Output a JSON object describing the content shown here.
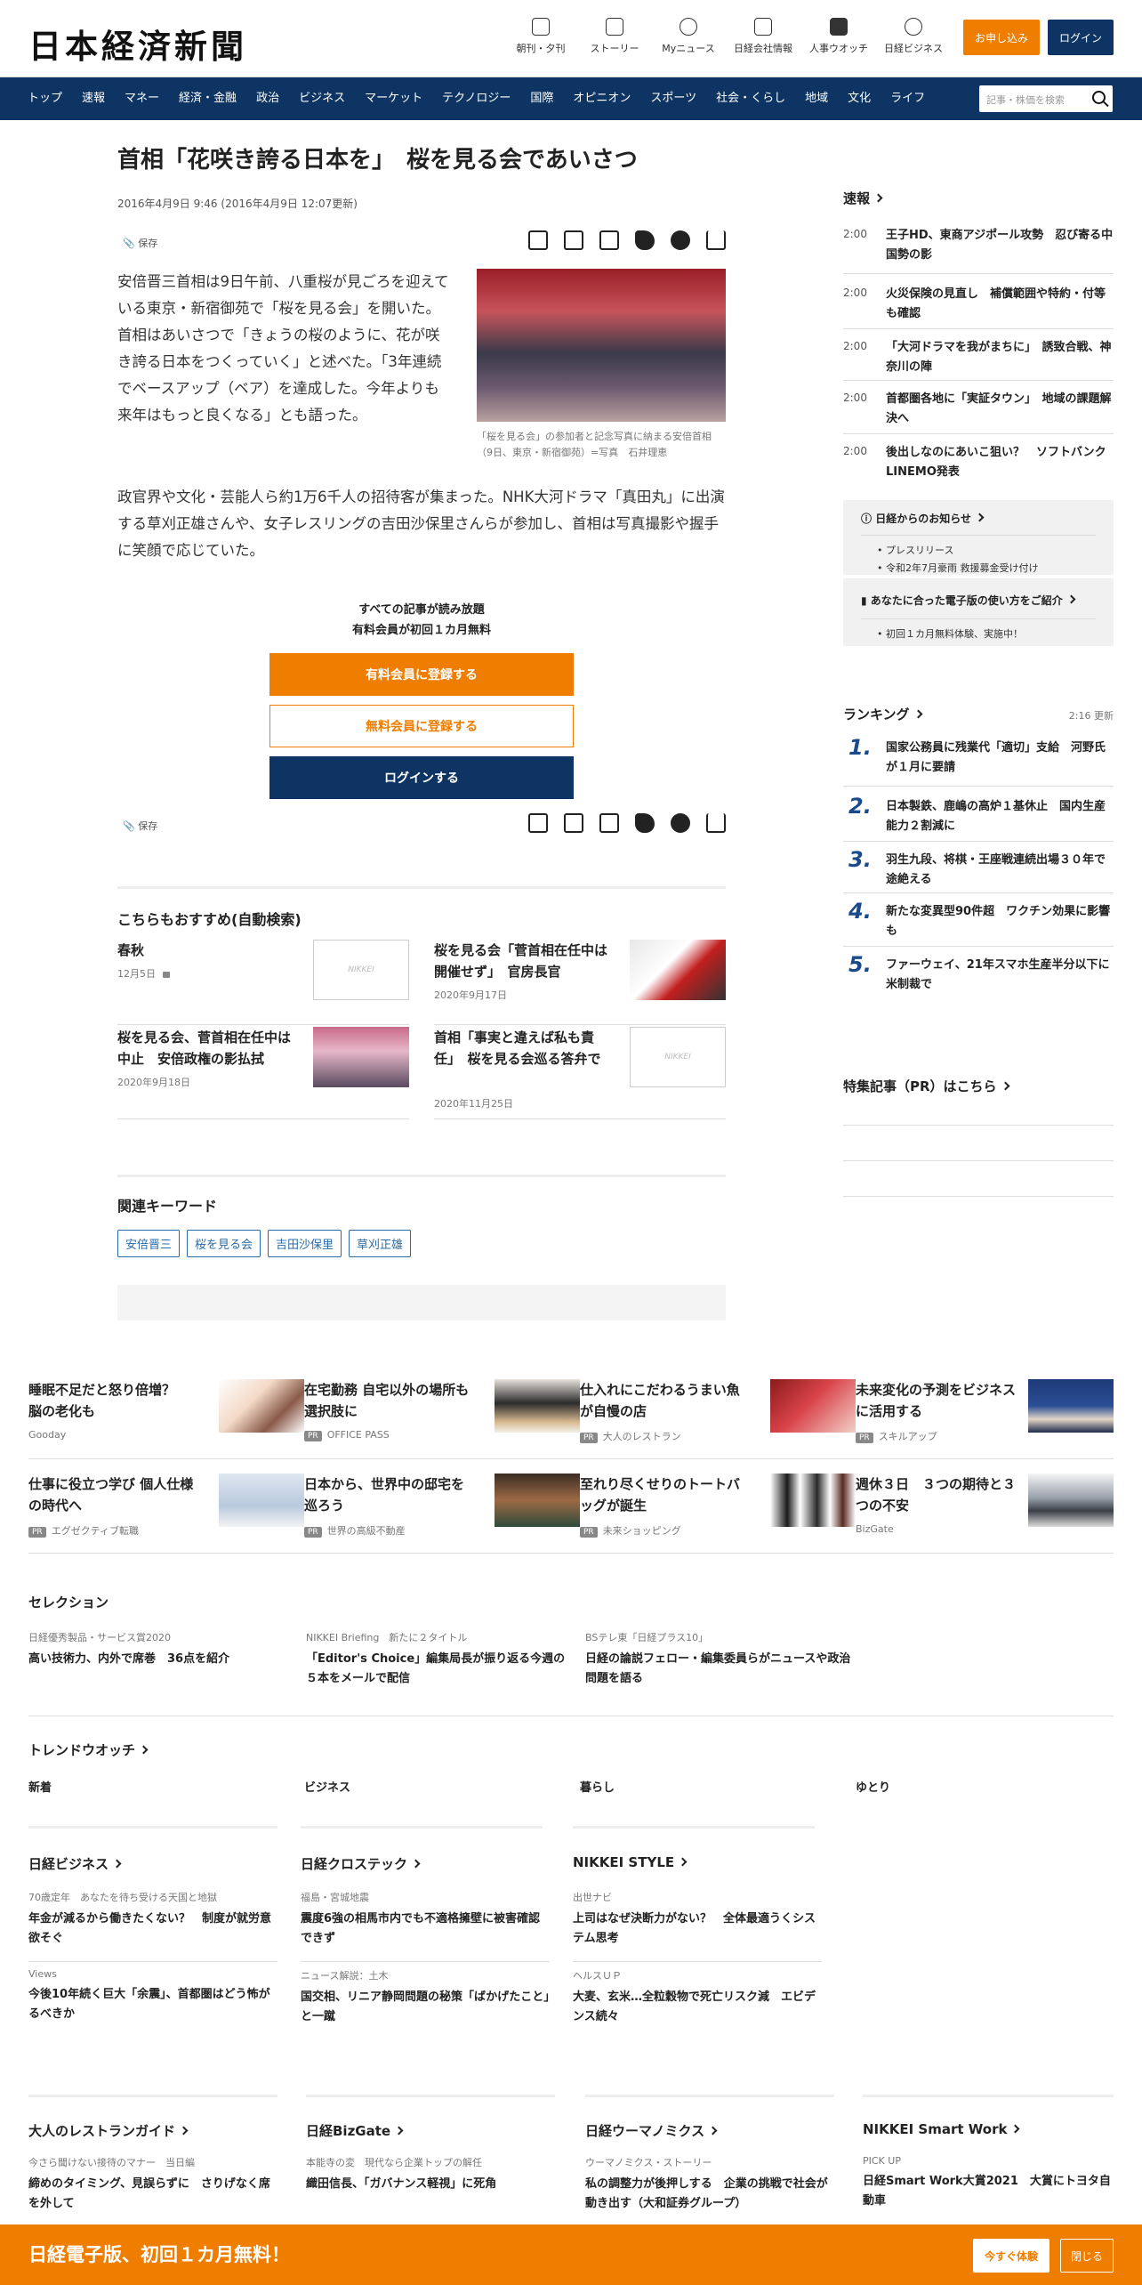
{
  "header": {
    "logo": "日本経済新聞",
    "utils": [
      "朝刊・夕刊",
      "ストーリー",
      "Myニュース",
      "日経会社情報",
      "人事ウオッチ",
      "日経ビジネス"
    ],
    "subscribe": "お申し込み",
    "login": "ログイン"
  },
  "nav": {
    "items": [
      "トップ",
      "速報",
      "マネー",
      "経済・金融",
      "政治",
      "ビジネス",
      "マーケット",
      "テクノロジー",
      "国際",
      "オピニオン",
      "スポーツ",
      "社会・くらし",
      "地域",
      "文化",
      "ライフ"
    ],
    "search_placeholder": "記事・株価を検索"
  },
  "article": {
    "title": "首相「花咲き誇る日本を」　桜を見る会であいさつ",
    "date": "2016年4月9日 9:46 (2016年4月9日 12:07更新)",
    "save": "保存",
    "para1": "安倍晋三首相は9日午前、八重桜が見ごろを迎えている東京・新宿御苑で「桜を見る会」を開いた。首相はあいさつで「きょうの桜のように、花が咲き誇る日本をつくっていく」と述べた。「3年連続でベースアップ（ベア）を達成した。今年よりも来年はもっと良くなる」とも語った。",
    "para2": "政官界や文化・芸能人ら約1万6千人の招待客が集まった。NHK大河ドラマ「真田丸」に出演する草刈正雄さんや、女子レスリングの吉田沙保里さんらが参加し、首相は写真撮影や握手に笑顔で応じていた。",
    "caption": "「桜を見る会」の参加者と記念写真に納まる安倍首相（9日、東京・新宿御苑）=写真　石井理恵",
    "paywall": {
      "line1": "すべての記事が読み放題",
      "line2": "有料会員が初回１カ月無料",
      "btn_paid": "有料会員に登録する",
      "btn_free": "無料会員に登録する",
      "btn_login": "ログインする"
    }
  },
  "recommend": {
    "heading": "こちらもおすすめ(自動検索)",
    "items": [
      {
        "title": "春秋",
        "date": "12月5日"
      },
      {
        "title": "桜を見る会「菅首相在任中は開催せず」　官房長官",
        "date": "2020年9月17日"
      },
      {
        "title": "桜を見る会、菅首相在任中は中止　安倍政権の影払拭",
        "date": "2020年9月18日"
      },
      {
        "title": "首相「事実と違えば私も責任」　桜を見る会巡る答弁で",
        "date": "2020年11月25日"
      }
    ],
    "nikkei_placeholder": "NIKKEI"
  },
  "keywords": {
    "heading": "関連キーワード",
    "items": [
      "安倍晋三",
      "桜を見る会",
      "吉田沙保里",
      "草刈正雄"
    ]
  },
  "sidebar": {
    "breaking_heading": "速報",
    "breaking": [
      {
        "time": "2:00",
        "text": "王子HD、東商アジポール攻勢　忍び寄る中国勢の影"
      },
      {
        "time": "2:00",
        "text": "火災保険の見直し　補償範囲や特約・付等も確認"
      },
      {
        "time": "2:00",
        "text": "「大河ドラマを我がまちに」　誘致合戦、神奈川の陣"
      },
      {
        "time": "2:00",
        "text": "首都圏各地に「実証タウン」　地域の課題解決へ"
      },
      {
        "time": "2:00",
        "text": "後出しなのにあいこ狙い？　ソフトバンクLINEMO発表"
      }
    ],
    "notice1": {
      "heading": "日経からのお知らせ",
      "items": [
        "プレスリリース",
        "令和2年7月豪雨 救援募金受け付け"
      ]
    },
    "notice2": {
      "heading": "あなたに合った電子版の使い方をご紹介",
      "items": [
        "初回１カ月無料体験、実施中！"
      ]
    },
    "ranking_heading": "ランキング",
    "ranking_updated": "2:16  更新",
    "ranking": [
      {
        "rank": "1.",
        "text": "国家公務員に残業代「適切」支給　河野氏が１月に要請"
      },
      {
        "rank": "2.",
        "text": "日本製鉄、鹿嶋の高炉１基休止　国内生産能力２割減に"
      },
      {
        "rank": "3.",
        "text": "羽生九段、将棋・王座戦連続出場３０年で途絶える"
      },
      {
        "rank": "4.",
        "text": "新たな変異型90件超　ワクチン効果に影響も"
      },
      {
        "rank": "5.",
        "text": "ファーウェイ、21年スマホ生産半分以下に　米制裁で"
      }
    ],
    "pr_heading": "特集記事（PR）はこちら"
  },
  "features": [
    {
      "title": "睡眠不足だと怒り倍増？　脳の老化も",
      "source": "Gooday",
      "pr": ""
    },
    {
      "title": "在宅勤務 自宅以外の場所も選択肢に",
      "source": "OFFICE PASS",
      "pr": "PR"
    },
    {
      "title": "仕入れにこだわるうまい魚が自慢の店",
      "source": "大人のレストラン",
      "pr": "PR"
    },
    {
      "title": "未来変化の予測をビジネスに活用する",
      "source": "スキルアップ",
      "pr": "PR"
    },
    {
      "title": "仕事に役立つ学び 個人仕様の時代へ",
      "source": "エグゼクティブ転職",
      "pr": "PR"
    },
    {
      "title": "日本から、世界中の邸宅を巡ろう",
      "source": "世界の高級不動産",
      "pr": "PR"
    },
    {
      "title": "至れり尽くせりのトートバッグが誕生",
      "source": "未来ショッピング",
      "pr": "PR"
    },
    {
      "title": "週休３日　３つの期待と３つの不安",
      "source": "BizGate",
      "pr": ""
    }
  ],
  "selection": {
    "heading": "セレクション",
    "items": [
      {
        "kicker": "日経優秀製品・サービス賞2020",
        "title": "高い技術力、内外で席巻　36点を紹介"
      },
      {
        "kicker": "NIKKEI Briefing　新たに２タイトル",
        "title": "「Editor's Choice」編集局長が振り返る今週の５本をメールで配信"
      },
      {
        "kicker": "BSテレ東「日経プラス10」",
        "title": "日経の論説フェロー・編集委員らがニュースや政治問題を語る"
      }
    ]
  },
  "trend": {
    "heading": "トレンドウオッチ",
    "cats": [
      "新着",
      "ビジネス",
      "暮らし",
      "ゆとり"
    ]
  },
  "groups": [
    {
      "heading": "日経ビジネス",
      "items": [
        {
          "kicker": "70歳定年　あなたを待ち受ける天国と地獄",
          "title": "年金が減るから働きたくない？　制度が就労意欲そぐ"
        },
        {
          "kicker": "Views",
          "title": "今後10年続く巨大「余震」、首都圏はどう怖がるべきか"
        }
      ]
    },
    {
      "heading": "日経クロステック",
      "items": [
        {
          "kicker": "福島・宮城地震",
          "title": "震度6強の相馬市内でも不適格擁壁に被害確認できず"
        },
        {
          "kicker": "ニュース解説：土木",
          "title": "国交相、リニア静岡問題の秘策「ばかげたこと」と一蹴"
        }
      ]
    },
    {
      "heading": "NIKKEI STYLE",
      "items": [
        {
          "kicker": "出世ナビ",
          "title": "上司はなぜ決断力がない？　全体最適うくシステム思考"
        },
        {
          "kicker": "ヘルスＵＰ",
          "title": "大麦、玄米…全粒穀物で死亡リスク減　エビデンス続々"
        }
      ]
    }
  ],
  "groups2": [
    {
      "heading": "大人のレストランガイド",
      "kicker": "今さら聞けない接待のマナー　当日編",
      "title": "締めのタイミング、見誤らずに　さりげなく席を外して"
    },
    {
      "heading": "日経BizGate",
      "kicker": "本能寺の変　現代なら企業トップの解任",
      "title": "織田信長、「ガバナンス軽視」に死角"
    },
    {
      "heading": "日経ウーマノミクス",
      "kicker": "ウーマノミクス・ストーリー",
      "title": "私の調整力が後押しする　企業の挑戦で社会が動き出す（大和証券グループ）"
    },
    {
      "heading": "NIKKEI Smart Work",
      "kicker": "PICK UP",
      "title": "日経Smart Work大賞2021　大賞にトヨタ自動車"
    }
  ],
  "footer": {
    "text": "日経電子版、初回１カ月無料！",
    "btn_try": "今すぐ体験",
    "btn_close": "閉じる"
  },
  "colors": {
    "navy": "#0d3462",
    "orange": "#ef7d00"
  }
}
